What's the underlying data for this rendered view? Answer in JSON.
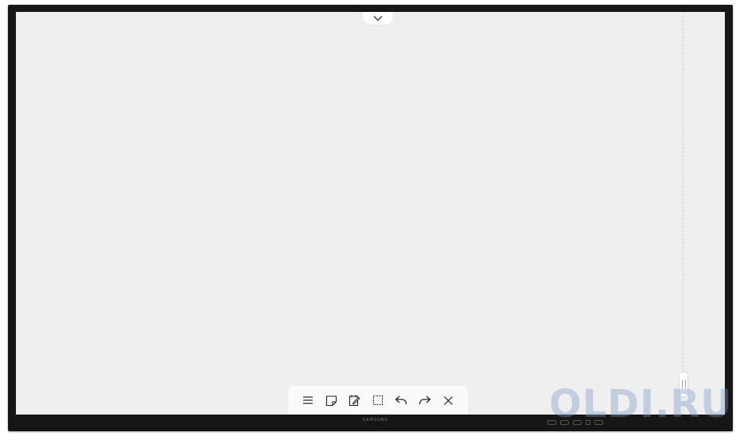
{
  "device": {
    "brand": "SAMSUNG",
    "screen_color": "#efefef",
    "bezel_color": "#161616"
  },
  "top_toggle": {
    "icon": "chevron-down-icon"
  },
  "toolbar": {
    "items": [
      {
        "id": "menu",
        "icon": "menu-icon"
      },
      {
        "id": "note",
        "icon": "sticky-note-icon"
      },
      {
        "id": "edit",
        "icon": "edit-note-icon"
      },
      {
        "id": "select",
        "icon": "selection-icon"
      },
      {
        "id": "undo",
        "icon": "undo-icon"
      },
      {
        "id": "redo",
        "icon": "redo-icon"
      },
      {
        "id": "close",
        "icon": "close-icon"
      }
    ]
  },
  "watermark": {
    "text": "OLDI.RU"
  }
}
